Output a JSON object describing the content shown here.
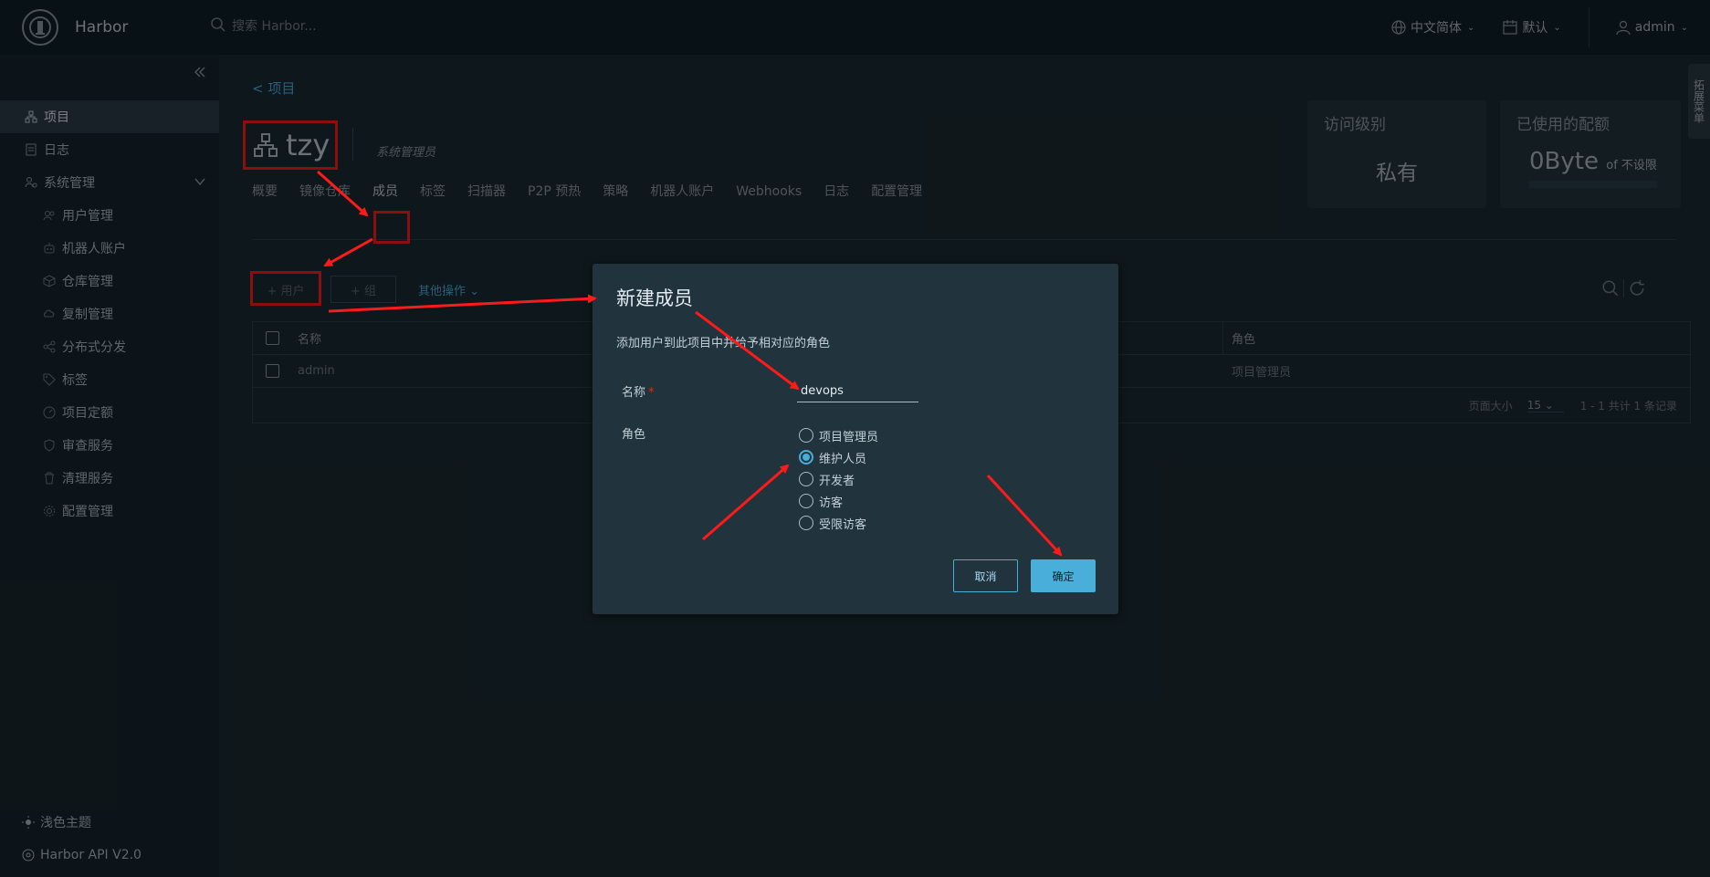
{
  "app": {
    "name": "Harbor"
  },
  "header": {
    "search_placeholder": "搜索 Harbor...",
    "language": "中文简体",
    "date_format": "默认",
    "user": "admin"
  },
  "sidebar": {
    "items": [
      {
        "label": "项目",
        "icon": "project-icon",
        "active": true
      },
      {
        "label": "日志",
        "icon": "log-icon"
      },
      {
        "label": "系统管理",
        "icon": "admin-icon",
        "expanded": true
      },
      {
        "label": "用户管理",
        "icon": "users-icon"
      },
      {
        "label": "机器人账户",
        "icon": "robot-icon"
      },
      {
        "label": "仓库管理",
        "icon": "registry-icon"
      },
      {
        "label": "复制管理",
        "icon": "replication-icon"
      },
      {
        "label": "分布式分发",
        "icon": "distribution-icon"
      },
      {
        "label": "标签",
        "icon": "label-icon"
      },
      {
        "label": "项目定额",
        "icon": "quota-icon"
      },
      {
        "label": "审查服务",
        "icon": "interrogation-icon"
      },
      {
        "label": "清理服务",
        "icon": "gc-icon"
      },
      {
        "label": "配置管理",
        "icon": "config-icon"
      }
    ],
    "bottom": {
      "theme": "浅色主题",
      "api": "Harbor API V2.0"
    }
  },
  "project": {
    "back": "< 项目",
    "name": "tzy",
    "role": "系统管理员",
    "access_level_title": "访问级别",
    "access_level": "私有",
    "quota_title": "已使用的配额",
    "quota_used": "0Byte",
    "quota_of": "of 不设限",
    "side_tab": "拓展菜单"
  },
  "tabs": [
    "概要",
    "镜像仓库",
    "成员",
    "标签",
    "扫描器",
    "P2P 预热",
    "策略",
    "机器人账户",
    "Webhooks",
    "日志",
    "配置管理"
  ],
  "members": {
    "add_user": "+ 用户",
    "add_group": "+ 组",
    "more_actions": "其他操作",
    "columns": {
      "name": "名称",
      "role": "角色"
    },
    "rows": [
      {
        "name": "admin",
        "role": "项目管理员"
      }
    ],
    "page_size_label": "页面大小",
    "page_size": "15",
    "total": "1 - 1 共计 1 条记录"
  },
  "modal": {
    "title": "新建成员",
    "description": "添加用户到此项目中并给予相对应的角色",
    "name_label": "名称",
    "name_value": "devops",
    "role_label": "角色",
    "roles": [
      "项目管理员",
      "维护人员",
      "开发者",
      "访客",
      "受限访客"
    ],
    "selected_role": "维护人员",
    "cancel": "取消",
    "ok": "确定"
  },
  "colors": {
    "accent": "#49aeda",
    "annotation": "#ff1a1a",
    "background": "#1b2a32"
  }
}
